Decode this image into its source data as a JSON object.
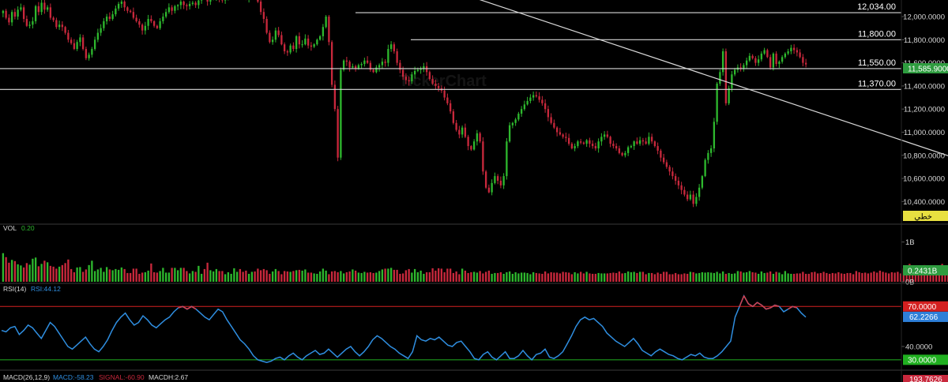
{
  "colors": {
    "background": "#000000",
    "up": "#2eb82e",
    "down": "#c8283c",
    "line": "#d9d9d9",
    "rsi_line": "#2f8ee0",
    "overbought": "#d42020",
    "oversold": "#20b020",
    "price_badge": "#2e9c3f",
    "linetype_badge": "#e8e040",
    "rsi_badge": "#2e7fd8",
    "macd_badge": "#c8283c",
    "text": "#d8d8d8",
    "muted": "#9a9a9a"
  },
  "watermark": "TickerChart",
  "chart_data": [
    {
      "type": "candlestick",
      "ylim": [
        10300,
        12130
      ],
      "y_ticks": [
        "12,000.0000",
        "11,800.0000",
        "11,600.0000",
        "11,400.0000",
        "11,200.0000",
        "11,000.0000",
        "10,800.0000",
        "10,600.0000",
        "10,400.0000"
      ],
      "y_tick_values": [
        12000,
        11800,
        11600,
        11400,
        11200,
        11000,
        10800,
        10600,
        10400
      ],
      "closes": [
        12050,
        11990,
        11950,
        12040,
        12000,
        12060,
        12080,
        11980,
        11920,
        11930,
        11960,
        12090,
        12040,
        12120,
        12060,
        12080,
        11990,
        11970,
        11910,
        11930,
        11910,
        11860,
        11800,
        11770,
        11720,
        11780,
        11820,
        11720,
        11640,
        11670,
        11720,
        11800,
        11860,
        11900,
        11960,
        12000,
        11980,
        12020,
        12070,
        12110,
        12130,
        12080,
        12050,
        12040,
        11990,
        11960,
        11930,
        11880,
        11920,
        11980,
        11960,
        11920,
        11900,
        11960,
        12000,
        12040,
        12080,
        12050,
        12090,
        12100,
        12130,
        12100,
        12090,
        12110,
        12120,
        12100,
        12140,
        12200,
        12160,
        12130,
        12150,
        12170,
        12180,
        12160,
        12140,
        12160,
        12180,
        12200,
        12220,
        12230,
        12200,
        12180,
        12160,
        12220,
        12260,
        12200,
        12130,
        12040,
        11980,
        11860,
        11780,
        11800,
        11880,
        11840,
        11760,
        11700,
        11690,
        11750,
        11720,
        11830,
        11760,
        11760,
        11810,
        11750,
        11740,
        11760,
        11800,
        11830,
        11910,
        12000,
        11780,
        11410,
        11200,
        10780,
        11540,
        11620,
        11610,
        11560,
        11570,
        11550,
        11580,
        11590,
        11620,
        11600,
        11540,
        11520,
        11560,
        11580,
        11610,
        11600,
        11720,
        11760,
        11700,
        11600,
        11540,
        11480,
        11450,
        11440,
        11500,
        11530,
        11540,
        11550,
        11570,
        11520,
        11460,
        11420,
        11400,
        11380,
        11360,
        11300,
        11250,
        11180,
        11080,
        11020,
        10980,
        11040,
        10960,
        10880,
        10850,
        10920,
        10990,
        10920,
        10660,
        10520,
        10480,
        10560,
        10620,
        10580,
        10540,
        10620,
        10920,
        11060,
        11080,
        11110,
        11160,
        11200,
        11240,
        11270,
        11300,
        11320,
        11310,
        11280,
        11250,
        11200,
        11130,
        11080,
        11040,
        11000,
        10980,
        10960,
        10950,
        10900,
        10860,
        10880,
        10920,
        10910,
        10900,
        10930,
        10900,
        10880,
        10860,
        10920,
        10960,
        10980,
        10960,
        10900,
        10880,
        10860,
        10820,
        10800,
        10820,
        10870,
        10880,
        10920,
        10900,
        10930,
        10920,
        10900,
        10960,
        10920,
        10880,
        10840,
        10780,
        10740,
        10700,
        10660,
        10620,
        10580,
        10540,
        10500,
        10460,
        10420,
        10460,
        10380,
        10440,
        10520,
        10620,
        10760,
        10820,
        10860,
        11090,
        11420,
        11520,
        11700,
        11250,
        11380,
        11500,
        11540,
        11560,
        11550,
        11580,
        11620,
        11660,
        11640,
        11600,
        11630,
        11680,
        11710,
        11650,
        11560,
        11680,
        11590,
        11610,
        11650,
        11680,
        11700,
        11730,
        11710,
        11690,
        11650,
        11600,
        11586
      ],
      "levels": [
        "12,034.00",
        "11,800.00",
        "11,550.00",
        "11,370.00"
      ],
      "level_values": [
        12034,
        11800,
        11550,
        11370
      ],
      "last_price": "11,585.9000",
      "line_type_badge": "خطي",
      "trendlines": [
        {
          "from_bar": 150,
          "from_value": 12240,
          "to_bar": 328,
          "to_value": 10720
        },
        {
          "from_bar": 320,
          "from_value": 10380,
          "to_bar": 360,
          "to_value": 11690
        }
      ]
    },
    {
      "type": "bar",
      "title": "VOL",
      "current_value": "0.20",
      "last_value_badge": "0.2431B",
      "y_ticks": [
        "1B",
        "0B"
      ],
      "y_tick_values": [
        1.0,
        0.0
      ],
      "ylim": [
        0,
        1.45
      ],
      "values": [
        0.72,
        0.62,
        0.48,
        0.55,
        0.52,
        0.44,
        0.41,
        0.36,
        0.47,
        0.43,
        0.58,
        0.61,
        0.39,
        0.45,
        0.53,
        0.49,
        0.4,
        0.38,
        0.33,
        0.38,
        0.42,
        0.47,
        0.56,
        0.32,
        0.24,
        0.36,
        0.37,
        0.25,
        0.31,
        0.42,
        0.53,
        0.27,
        0.31,
        0.35,
        0.25,
        0.37,
        0.31,
        0.29,
        0.32,
        0.3,
        0.36,
        0.32,
        0.22,
        0.22,
        0.33,
        0.33,
        0.2,
        0.23,
        0.24,
        0.28,
        0.46,
        0.24,
        0.23,
        0.27,
        0.35,
        0.23,
        0.23,
        0.35,
        0.35,
        0.29,
        0.35,
        0.35,
        0.27,
        0.21,
        0.27,
        0.25,
        0.4,
        0.2,
        0.32,
        0.48,
        0.29,
        0.26,
        0.32,
        0.27,
        0.27,
        0.19,
        0.24,
        0.2,
        0.34,
        0.25,
        0.32,
        0.25,
        0.28,
        0.2,
        0.25,
        0.26,
        0.33,
        0.29,
        0.32,
        0.29,
        0.2,
        0.26,
        0.32,
        0.27,
        0.19,
        0.27,
        0.26,
        0.25,
        0.27,
        0.29,
        0.3,
        0.28,
        0.31,
        0.23,
        0.23,
        0.21,
        0.2,
        0.26,
        0.33,
        0.28,
        0.19,
        0.26,
        0.27,
        0.24,
        0.27,
        0.21,
        0.24,
        0.26,
        0.31,
        0.28,
        0.23,
        0.22,
        0.25,
        0.23,
        0.24,
        0.22,
        0.23,
        0.27,
        0.31,
        0.33,
        0.33,
        0.35,
        0.3,
        0.3,
        0.2,
        0.21,
        0.29,
        0.32,
        0.23,
        0.32,
        0.24,
        0.28,
        0.2,
        0.24,
        0.24,
        0.34,
        0.28,
        0.34,
        0.33,
        0.24,
        0.33,
        0.33,
        0.22,
        0.26,
        0.19,
        0.33,
        0.28,
        0.22,
        0.24,
        0.25,
        0.23,
        0.27,
        0.21,
        0.25,
        0.28,
        0.2,
        0.22,
        0.22,
        0.24,
        0.2,
        0.24,
        0.26,
        0.2,
        0.24,
        0.21,
        0.23,
        0.23,
        0.22,
        0.19,
        0.24,
        0.22,
        0.21,
        0.2,
        0.26,
        0.21,
        0.24,
        0.23,
        0.23,
        0.21,
        0.25,
        0.24,
        0.23,
        0.19,
        0.24,
        0.21,
        0.25,
        0.21,
        0.25,
        0.21,
        0.2,
        0.2,
        0.22,
        0.21,
        0.21,
        0.21,
        0.22,
        0.23,
        0.22,
        0.26,
        0.21,
        0.22,
        0.26,
        0.24,
        0.25,
        0.22,
        0.25,
        0.25,
        0.19,
        0.22,
        0.22,
        0.19,
        0.23,
        0.2,
        0.25,
        0.25,
        0.19,
        0.19,
        0.22,
        0.19,
        0.19,
        0.21,
        0.2,
        0.25,
        0.24,
        0.21,
        0.22,
        0.24,
        0.23,
        0.24,
        0.23,
        0.22,
        0.25,
        0.21,
        0.26,
        0.2,
        0.22,
        0.2,
        0.21,
        0.27,
        0.26,
        0.23,
        0.24,
        0.27,
        0.24,
        0.23,
        0.2,
        0.26,
        0.22,
        0.23,
        0.26,
        0.2,
        0.25,
        0.23,
        0.19,
        0.27,
        0.21,
        0.2,
        0.2,
        0.21,
        0.21,
        0.25,
        0.2,
        0.2,
        0.24,
        0.25,
        0.21,
        0.22,
        0.25,
        0.22,
        0.2,
        0.22,
        0.21,
        0.24,
        0.21,
        0.2,
        0.22,
        0.22,
        0.19,
        0.27,
        0.24,
        0.22,
        0.23,
        0.21,
        0.23,
        0.26,
        0.23,
        0.28,
        0.25,
        0.23,
        0.21,
        0.24,
        0.23,
        0.25,
        0.21,
        0.34,
        0.37,
        0.45,
        0.35,
        0.3,
        0.27,
        0.36,
        0.42,
        0.36,
        0.33,
        0.3,
        0.26,
        0.33,
        0.45,
        0.35,
        0.28,
        0.33,
        0.25,
        0.3,
        0.28,
        0.24,
        0.31,
        0.26,
        0.23,
        0.26,
        0.24,
        0.25,
        0.23,
        0.25,
        0.24,
        0.24
      ]
    },
    {
      "type": "line",
      "title": "RSI(14)",
      "current_value": "RSI:44.12",
      "ylim": [
        24,
        82
      ],
      "y_ticks": [
        "40.0000"
      ],
      "y_tick_values": [
        40
      ],
      "reference_lines": [
        "70.0000",
        "30.0000"
      ],
      "reference_values": [
        70,
        30
      ],
      "last_value_badge": "62.2266",
      "values": [
        52,
        51,
        54,
        55,
        49,
        52,
        56,
        54,
        50,
        46,
        52,
        58,
        55,
        50,
        45,
        40,
        38,
        41,
        44,
        47,
        42,
        38,
        36,
        40,
        45,
        52,
        58,
        62,
        65,
        60,
        56,
        58,
        63,
        60,
        56,
        54,
        57,
        60,
        62,
        66,
        69,
        70,
        68,
        70,
        68,
        65,
        62,
        60,
        64,
        68,
        66,
        60,
        55,
        50,
        45,
        42,
        38,
        33,
        30,
        29,
        28,
        29,
        31,
        32,
        30,
        33,
        35,
        32,
        30,
        33,
        35,
        37,
        34,
        35,
        38,
        35,
        32,
        35,
        38,
        40,
        36,
        33,
        36,
        40,
        45,
        48,
        46,
        43,
        40,
        38,
        35,
        33,
        31,
        36,
        48,
        45,
        44,
        46,
        45,
        47,
        44,
        41,
        40,
        43,
        44,
        40,
        36,
        31,
        30,
        34,
        36,
        32,
        30,
        33,
        36,
        31,
        31,
        33,
        37,
        33,
        30,
        34,
        35,
        38,
        32,
        31,
        33,
        36,
        42,
        48,
        55,
        60,
        62,
        60,
        61,
        58,
        55,
        50,
        47,
        44,
        42,
        40,
        43,
        46,
        42,
        37,
        35,
        33,
        36,
        38,
        36,
        34,
        33,
        31,
        30,
        32,
        34,
        33,
        35,
        32,
        31,
        31,
        33,
        36,
        40,
        44,
        62,
        70,
        78,
        72,
        70,
        73,
        71,
        68,
        69,
        71,
        70,
        66,
        68,
        70,
        69,
        65,
        62
      ]
    },
    {
      "type": "line",
      "title": "MACD(26,12,9)",
      "series_labels": [
        "MACD:-58.23",
        "SIGNAL:-60.90",
        "MACDH:2.67"
      ],
      "last_value_badge": "193.7626"
    }
  ]
}
